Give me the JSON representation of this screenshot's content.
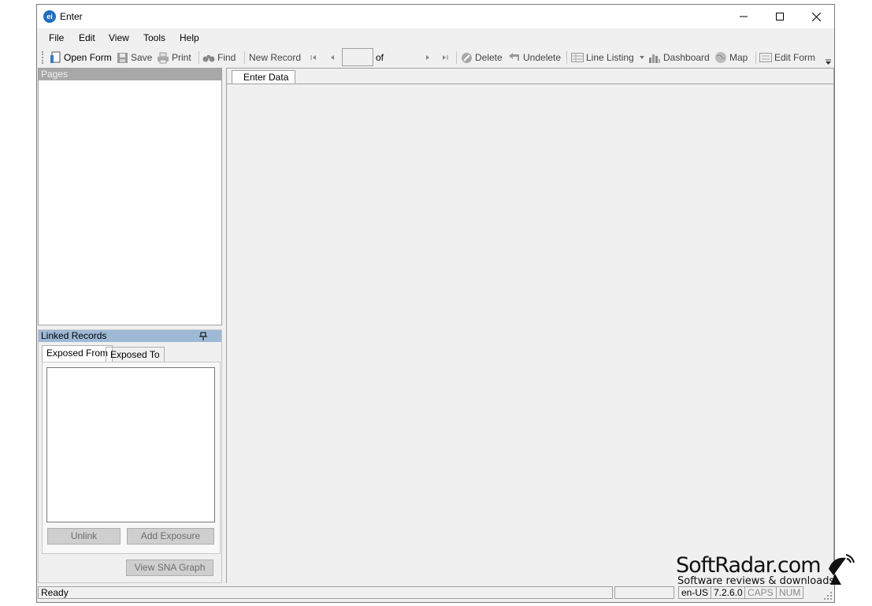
{
  "window": {
    "app_icon": "ei",
    "title": "Enter",
    "controls": {
      "minimize_icon": "minimize-icon",
      "maximize_icon": "maximize-icon",
      "close_icon": "close-icon"
    }
  },
  "menu": [
    "File",
    "Edit",
    "View",
    "Tools",
    "Help"
  ],
  "toolbar": {
    "open_form": "Open Form",
    "save": "Save",
    "print": "Print",
    "find": "Find",
    "new_record": "New Record",
    "record_of": "of",
    "record_value": "",
    "delete": "Delete",
    "undelete": "Undelete",
    "line_listing": "Line Listing",
    "dashboard": "Dashboard",
    "map": "Map",
    "edit_form": "Edit Form"
  },
  "pages_panel": {
    "title": "Pages"
  },
  "linked_records": {
    "title": "Linked Records",
    "tabs": [
      "Exposed From",
      "Exposed To"
    ],
    "unlink": "Unlink",
    "add_exposure": "Add Exposure",
    "view_sna_graph": "View SNA Graph"
  },
  "main": {
    "tab": "Enter Data"
  },
  "status": {
    "text": "Ready",
    "locale": "en-US",
    "version": "7.2.6.0",
    "caps": "CAPS",
    "num": "NUM"
  },
  "watermark": {
    "title": "SoftRadar.com",
    "subtitle": "Software reviews & downloads"
  },
  "colors": {
    "accent": "#1f6fc0",
    "panel_header_blue": "#9db9d6",
    "panel_header_gray": "#a8a8a8"
  }
}
